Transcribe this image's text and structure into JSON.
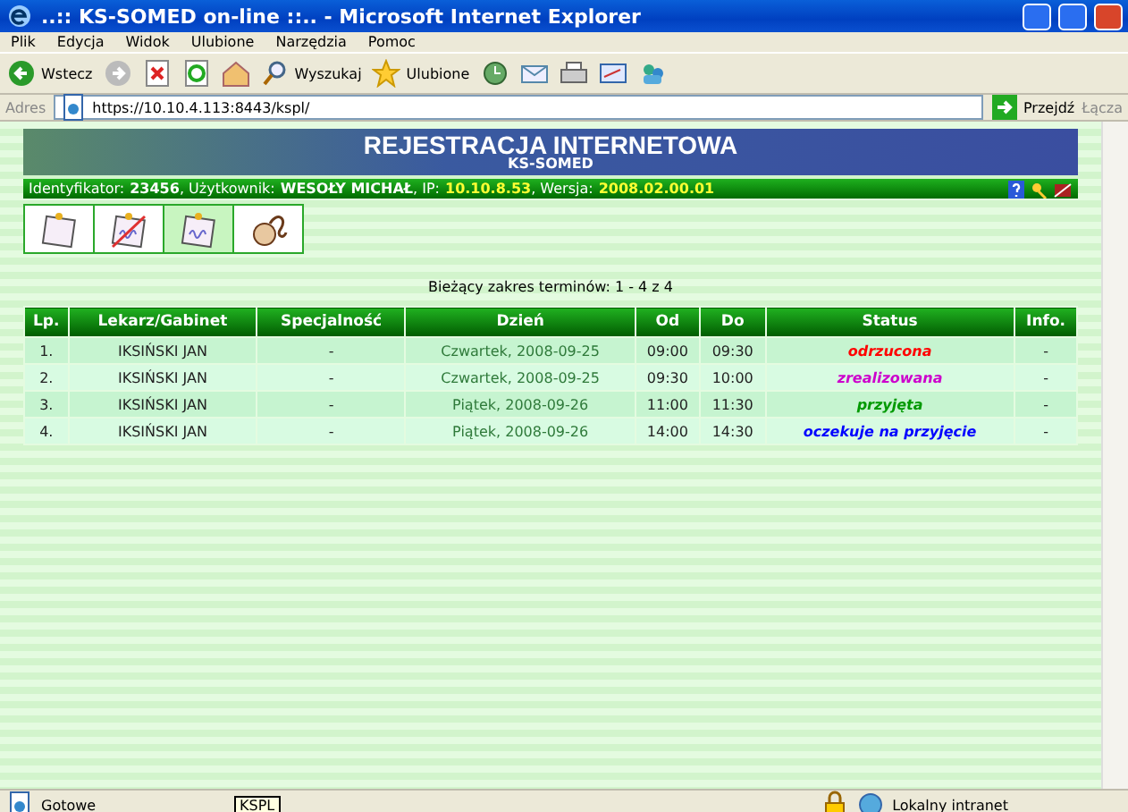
{
  "window": {
    "title": "..:: KS-SOMED on-line ::.. - Microsoft Internet Explorer"
  },
  "menu": [
    "Plik",
    "Edycja",
    "Widok",
    "Ulubione",
    "Narzędzia",
    "Pomoc"
  ],
  "toolbar": {
    "back": "Wstecz",
    "search": "Wyszukaj",
    "favorites": "Ulubione"
  },
  "address": {
    "label": "Adres",
    "value": "https://10.10.4.113:8443/kspl/",
    "go": "Przejdź",
    "links": "Łącza"
  },
  "banner": {
    "title": "REJESTRACJA INTERNETOWA",
    "subtitle": "KS-SOMED"
  },
  "info_bar": [
    {
      "label": "Identyfikator:",
      "value": "23456",
      "kind": "plain"
    },
    {
      "label": ", Użytkownik:",
      "value": "WESOŁY MICHAŁ",
      "kind": "plain"
    },
    {
      "label": ", IP:",
      "value": "10.10.8.53",
      "kind": "highlight"
    },
    {
      "label": ", Wersja:",
      "value": "2008.02.00.01",
      "kind": "highlight"
    }
  ],
  "tabs": [
    {
      "selected": false
    },
    {
      "selected": false
    },
    {
      "selected": true
    },
    {
      "selected": false
    }
  ],
  "range": "Bieżący zakres terminów: 1 - 4 z 4",
  "table": {
    "columns": [
      "Lp.",
      "Lekarz/Gabinet",
      "Specjalność",
      "Dzień",
      "Od",
      "Do",
      "Status",
      "Info."
    ],
    "rows": [
      {
        "lp": "1.",
        "doctor": "IKSIŃSKI JAN",
        "specialty": "-",
        "day": "Czwartek, 2008-09-25",
        "from": "09:00",
        "to": "09:30",
        "status": "odrzucona",
        "color": "#ff0000",
        "info": "-"
      },
      {
        "lp": "2.",
        "doctor": "IKSIŃSKI JAN",
        "specialty": "-",
        "day": "Czwartek, 2008-09-25",
        "from": "09:30",
        "to": "10:00",
        "status": "zrealizowana",
        "color": "#cc00cc",
        "info": "-"
      },
      {
        "lp": "3.",
        "doctor": "IKSIŃSKI JAN",
        "specialty": "-",
        "day": "Piątek, 2008-09-26",
        "from": "11:00",
        "to": "11:30",
        "status": "przyjęta",
        "color": "#009900",
        "info": "-"
      },
      {
        "lp": "4.",
        "doctor": "IKSIŃSKI JAN",
        "specialty": "-",
        "day": "Piątek, 2008-09-26",
        "from": "14:00",
        "to": "14:30",
        "status": "oczekuje na przyjęcie",
        "color": "#0000ff",
        "info": "-"
      }
    ]
  },
  "status_bar": {
    "text": "Gotowe",
    "tooltip": "KSPL",
    "zone": "Lokalny intranet"
  }
}
